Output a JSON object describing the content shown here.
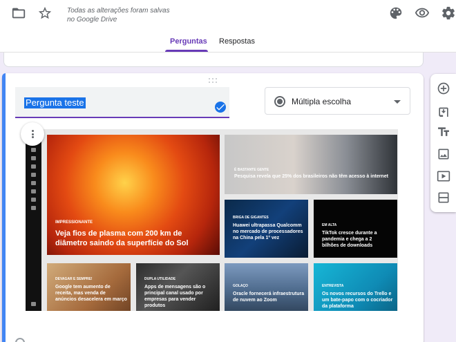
{
  "header": {
    "save_note": "Todas as alterações foram salvas no Google Drive",
    "icons": [
      "folder-icon",
      "star-icon",
      "palette-icon",
      "eye-icon",
      "gear-icon"
    ]
  },
  "tabs": [
    {
      "label": "Perguntas",
      "active": true
    },
    {
      "label": "Respostas",
      "active": false
    }
  ],
  "question": {
    "title": "Pergunta  teste",
    "type": "Múltipla escolha"
  },
  "image": {
    "tiles": [
      {
        "category": "IMPRESSIONANTE",
        "title": "Veja fios de plasma com 200 km de diâmetro saindo da superfície do Sol"
      },
      {
        "category": "É BASTANTE GENTE",
        "title": "Pesquisa revela que 25% dos brasileiros não têm acesso à internet"
      },
      {
        "category": "BRIGA DE GIGANTES",
        "title": "Huawei ultrapassa Qualcomm no mercado de processadores na China pela 1º vez"
      },
      {
        "category": "EM ALTA",
        "title": "TikTok cresce durante a pandemia e chega a 2 bilhões de downloads"
      },
      {
        "category": "DEVAGAR E SEMPRE!",
        "title": "Google tem aumento de receita, mas venda de anúncios desacelera em março"
      },
      {
        "category": "DUPLA UTILIDADE",
        "title": "Apps de mensagens são o principal canal usado por empresas para vender produtos"
      },
      {
        "category": "GOLAÇO",
        "title": "Oracle fornecerá infraestrutura de nuvem ao Zoom"
      },
      {
        "category": "ENTREVISTA",
        "title": "Os novos recursos do Trello e um bate-papo com o cocriador da plataforma"
      }
    ]
  },
  "side_toolbar": [
    "add-question-icon",
    "import-questions-icon",
    "title-text-icon",
    "image-icon",
    "video-icon",
    "section-icon"
  ],
  "colors": {
    "accent": "#673ab7",
    "selection": "#1a73e8",
    "card_accent": "#4285f4",
    "background": "#f0ebf8"
  }
}
